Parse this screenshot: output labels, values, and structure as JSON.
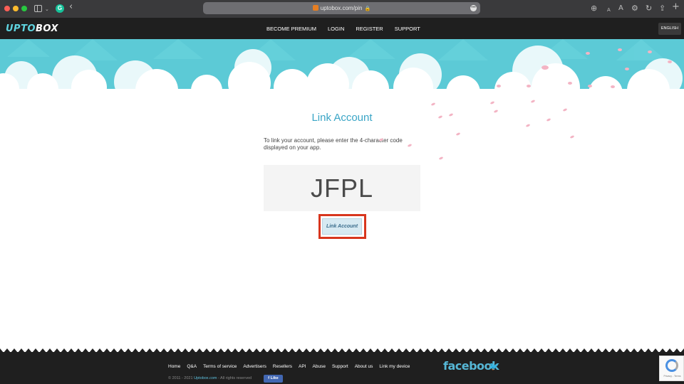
{
  "browser": {
    "url": "uptobox.com/pin",
    "icons": [
      "sidebar-icon",
      "grammarly-icon",
      "back-icon",
      "lock-icon",
      "download-icon",
      "text-size-small-icon",
      "text-size-large-icon",
      "settings-icon",
      "reload-icon",
      "share-icon",
      "new-tab-icon"
    ],
    "text_small": "A",
    "text_large": "A"
  },
  "site": {
    "logo_part1": "UPTO",
    "logo_part2": "BOX",
    "nav": [
      "BECOME PREMIUM",
      "LOGIN",
      "REGISTER",
      "SUPPORT"
    ],
    "language": "ENGLISH",
    "accent_color": "#3aa5c6"
  },
  "main": {
    "title": "Link Account",
    "instructions": "To link your account, please enter the 4-character code displayed on your app.",
    "code": "JFPL",
    "button_label": "Link Account"
  },
  "footer": {
    "links": [
      "Home",
      "Q&A",
      "Terms of service",
      "Advertisers",
      "Resellers",
      "API",
      "Abuse",
      "Support",
      "About us",
      "Link my device"
    ],
    "copyright_prefix": "© 2011 - 2021 ",
    "copyright_site": "Uptobox.com",
    "copyright_suffix": " - All rights reserved",
    "like_label": "Like",
    "facebook_label": "facebook",
    "recaptcha_text": "Privacy - Terms"
  }
}
